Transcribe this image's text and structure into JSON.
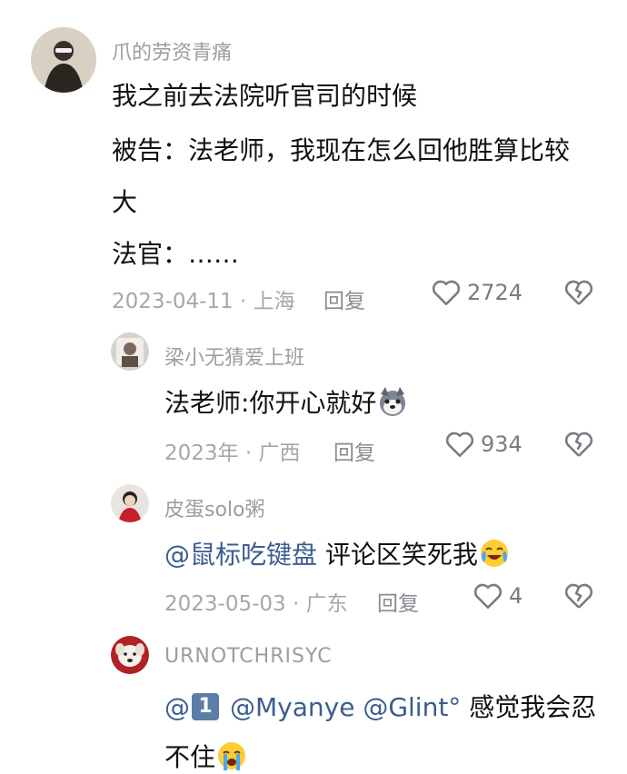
{
  "comments": [
    {
      "username": "爪的劳资青痛",
      "lines": [
        "我之前去法院听官司的时候",
        "被告：法老师，我现在怎么回他胜算比较",
        "大",
        "法官：……"
      ],
      "meta": "2023-04-11 · 上海",
      "reply": "回复",
      "likes": "2724",
      "avatar_icon": "person-avatar",
      "like_icon": "heart-outline-icon",
      "dislike_icon": "broken-heart-icon"
    },
    {
      "username": "梁小无猜爱上班",
      "text": "法老师:你开心就好",
      "emoji": "husky-emoji",
      "meta": "2023年 · 广西",
      "reply": "回复",
      "likes": "934"
    },
    {
      "username": "皮蛋solo粥",
      "mention": "@鼠标吃键盘",
      "text": " 评论区笑死我",
      "emoji": "crying-laughing-emoji",
      "meta": "2023-05-03 · 广东",
      "reply": "回复",
      "likes": "4"
    },
    {
      "username": "URNOTCHRISYC",
      "mention1": "@",
      "keycap": "1",
      "mention2": "@Myanye @Glint°",
      "text": " 感觉我会忍",
      "text2": "不住",
      "emoji": "crying-emoji"
    }
  ],
  "colors": {
    "mention": "#3b5d8f",
    "meta": "#a6a6ad",
    "username": "#9c9ca3"
  }
}
